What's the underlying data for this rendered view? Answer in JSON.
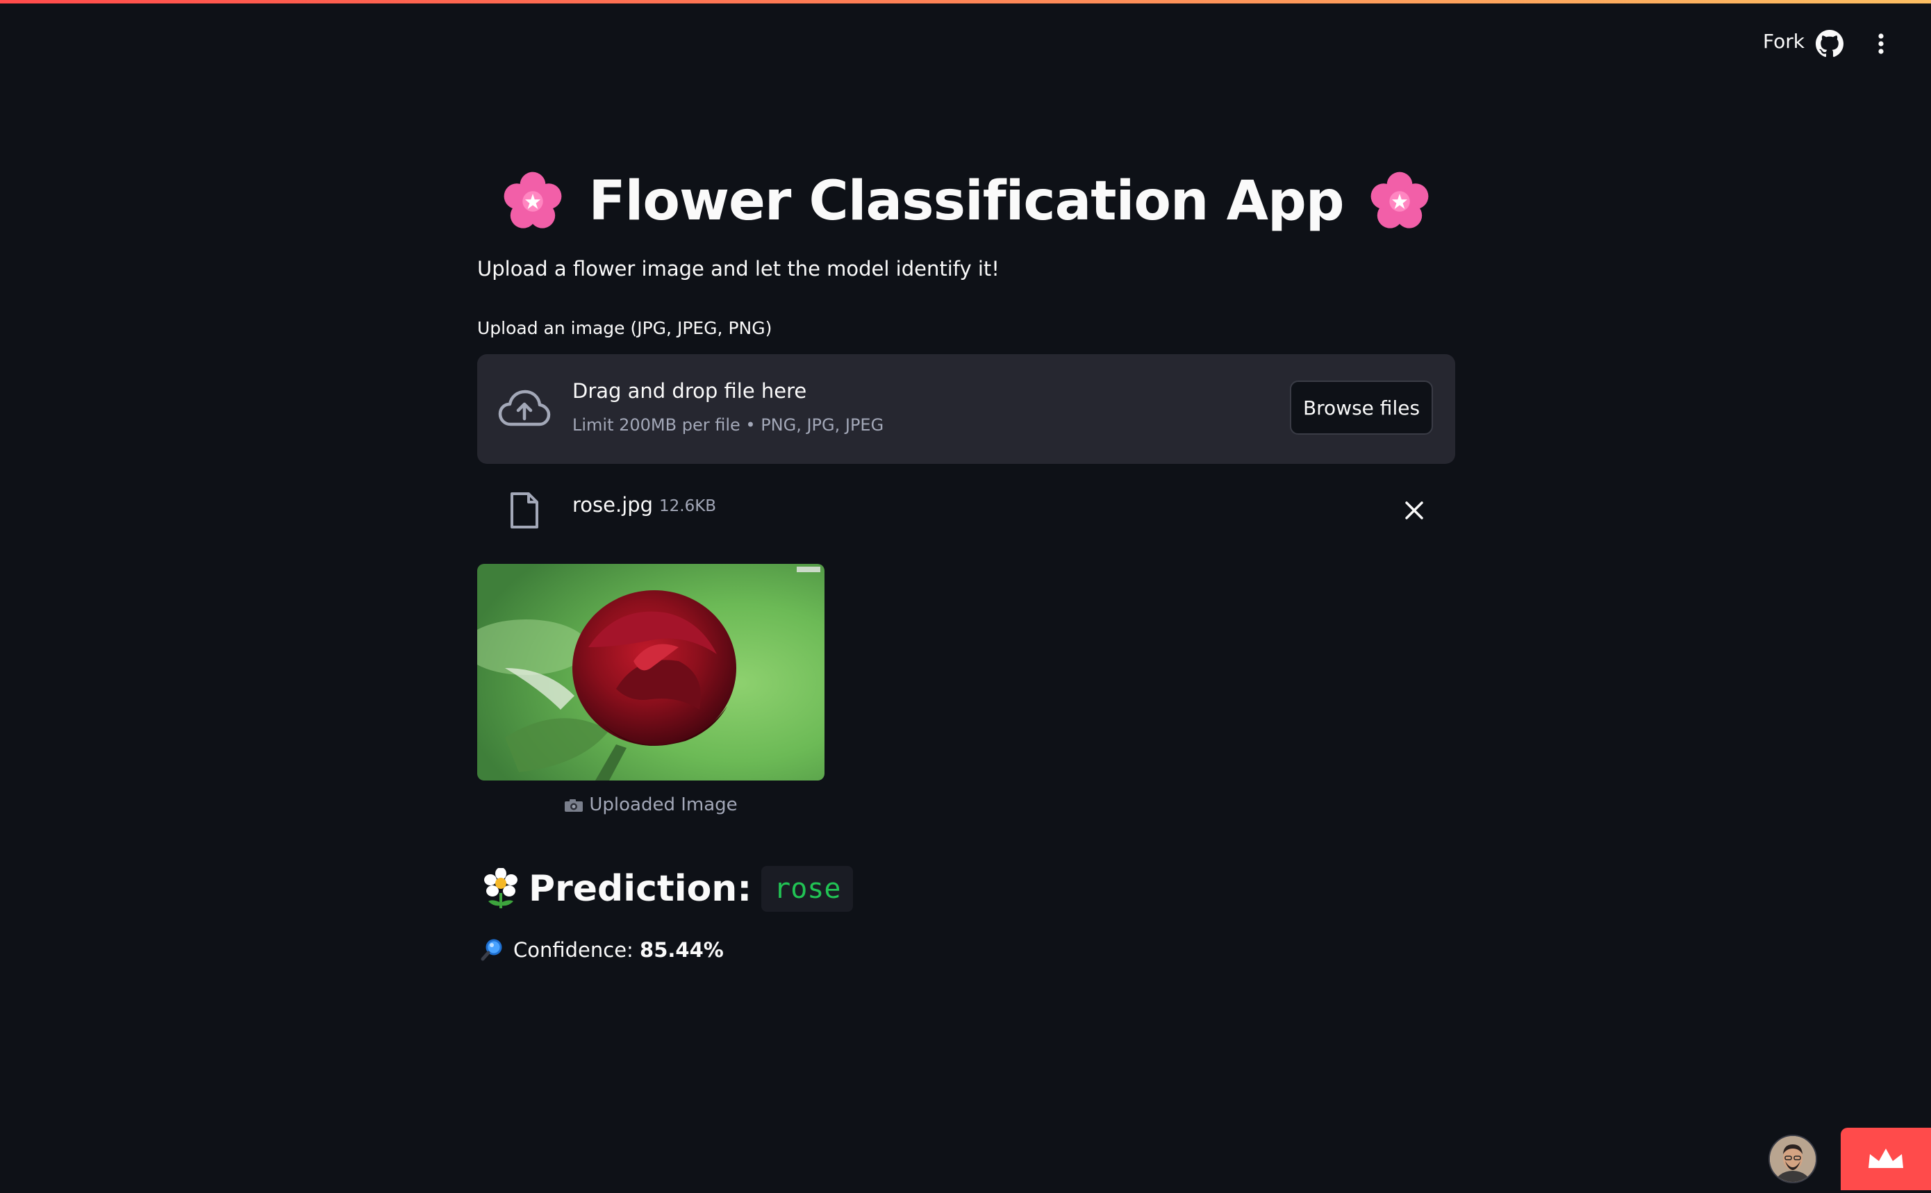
{
  "header": {
    "fork_label": "Fork",
    "icons": [
      "github-icon",
      "more-vertical-icon"
    ]
  },
  "app": {
    "title": "Flower Classification App",
    "title_emoji": "cherry-blossom",
    "subtitle": "Upload a flower image and let the model identify it!"
  },
  "uploader": {
    "label": "Upload an image (JPG, JPEG, PNG)",
    "drop_title": "Drag and drop file here",
    "drop_limit": "Limit 200MB per file • PNG, JPG, JPEG",
    "browse_label": "Browse files"
  },
  "file": {
    "name": "rose.jpg",
    "size": "12.6KB"
  },
  "image": {
    "caption": "Uploaded Image"
  },
  "result": {
    "prediction_label": "Prediction:",
    "prediction_value": "rose",
    "confidence_label": "Confidence:",
    "confidence_value": "85.44%"
  },
  "colors": {
    "background": "#0e1117",
    "dropzone": "#262730",
    "accent": "#ff4b4b",
    "code_green": "#21c354"
  }
}
